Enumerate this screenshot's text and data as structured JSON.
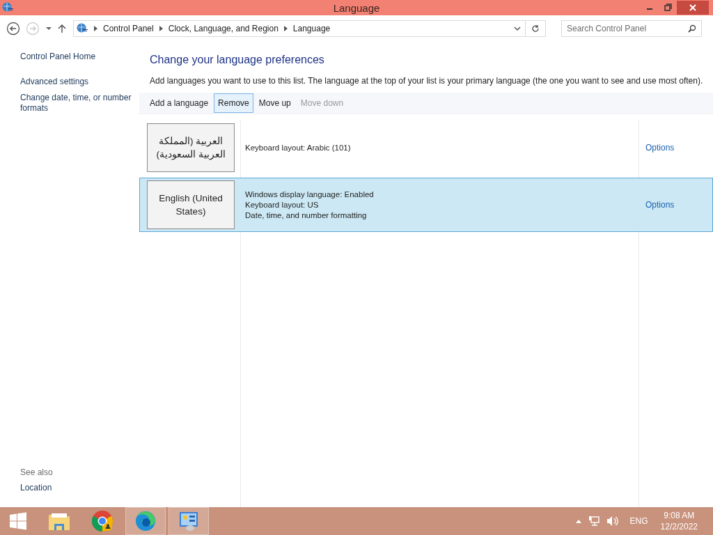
{
  "window": {
    "title": "Language"
  },
  "address_bar": {
    "breadcrumbs": [
      "Control Panel",
      "Clock, Language, and Region",
      "Language"
    ],
    "search_placeholder": "Search Control Panel"
  },
  "sidebar": {
    "items": [
      "Control Panel Home",
      "Advanced settings",
      "Change date, time, or number formats"
    ],
    "see_also_heading": "See also",
    "see_also_items": [
      "Location"
    ]
  },
  "main": {
    "heading": "Change your language preferences",
    "description": "Add languages you want to use to this list. The language at the top of your list is your primary language (the one you want to see and use most often).",
    "toolbar": [
      {
        "label": "Add a language",
        "highlighted": false,
        "disabled": false
      },
      {
        "label": "Remove",
        "highlighted": true,
        "disabled": false
      },
      {
        "label": "Move up",
        "highlighted": false,
        "disabled": false
      },
      {
        "label": "Move down",
        "highlighted": false,
        "disabled": true
      }
    ],
    "languages": [
      {
        "name": "العربية (المملكة العربية السعودية)",
        "details": [
          "Keyboard layout: Arabic (101)"
        ],
        "options": "Options",
        "selected": false
      },
      {
        "name": "English (United States)",
        "details": [
          "Windows display language: Enabled",
          "Keyboard layout: US",
          "Date, time, and number formatting"
        ],
        "options": "Options",
        "selected": true
      }
    ]
  },
  "taskbar": {
    "apps": [
      {
        "kind": "folder",
        "active": false
      },
      {
        "kind": "chrome",
        "active": false
      },
      {
        "kind": "edge",
        "active": true
      },
      {
        "kind": "control-panel",
        "active": true
      }
    ],
    "tray": {
      "language": "ENG",
      "time": "9:08 AM",
      "date": "12/2/2022"
    }
  }
}
